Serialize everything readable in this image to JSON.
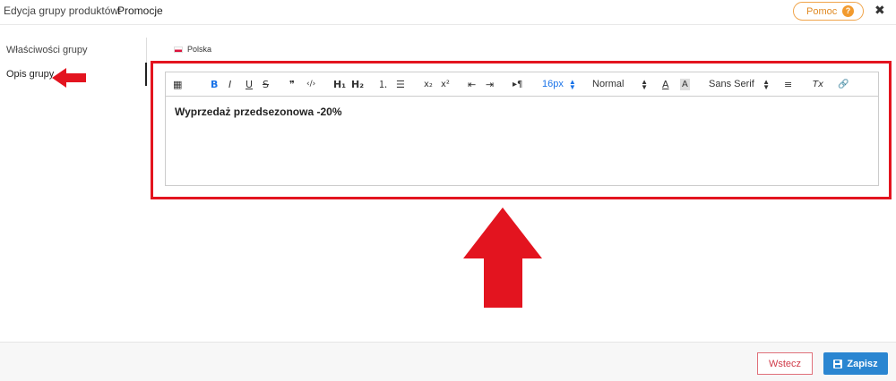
{
  "header": {
    "title_label": "Edycja grupy produktów:",
    "title_value": "Promocje",
    "help_label": "Pomoc",
    "help_icon": "?",
    "close_icon": "✖"
  },
  "sidebar": {
    "items": [
      {
        "label": "Właściwości grupy"
      },
      {
        "label": "Opis grupy"
      }
    ]
  },
  "language_tab": {
    "label": "Polska",
    "flag": "pl-flag-icon"
  },
  "toolbar": {
    "table_icon": "▦",
    "bold": "B",
    "italic": "I",
    "underline": "U",
    "strike": "S",
    "quote": "❞",
    "code": "‹/›",
    "h1": "H₁",
    "h2": "H₂",
    "ordered_list": "⒈",
    "bullet_list": "☰",
    "subscript": "x₂",
    "superscript": "x²",
    "outdent": "⇤",
    "indent": "⇥",
    "direction": "▸¶",
    "font_size": "16px",
    "heading_select": "Normal",
    "text_color": "A",
    "bg_color": "A",
    "font_family": "Sans Serif",
    "align": "≡",
    "clear": "Tx",
    "link": "🔗"
  },
  "editor": {
    "content": "Wyprzedaż przedsezonowa -20%"
  },
  "footer": {
    "back_label": "Wstecz",
    "save_label": "Zapisz"
  },
  "colors": {
    "highlight": "#e3141f",
    "save_button": "#2a86d1",
    "help_accent": "#f29a2e"
  }
}
